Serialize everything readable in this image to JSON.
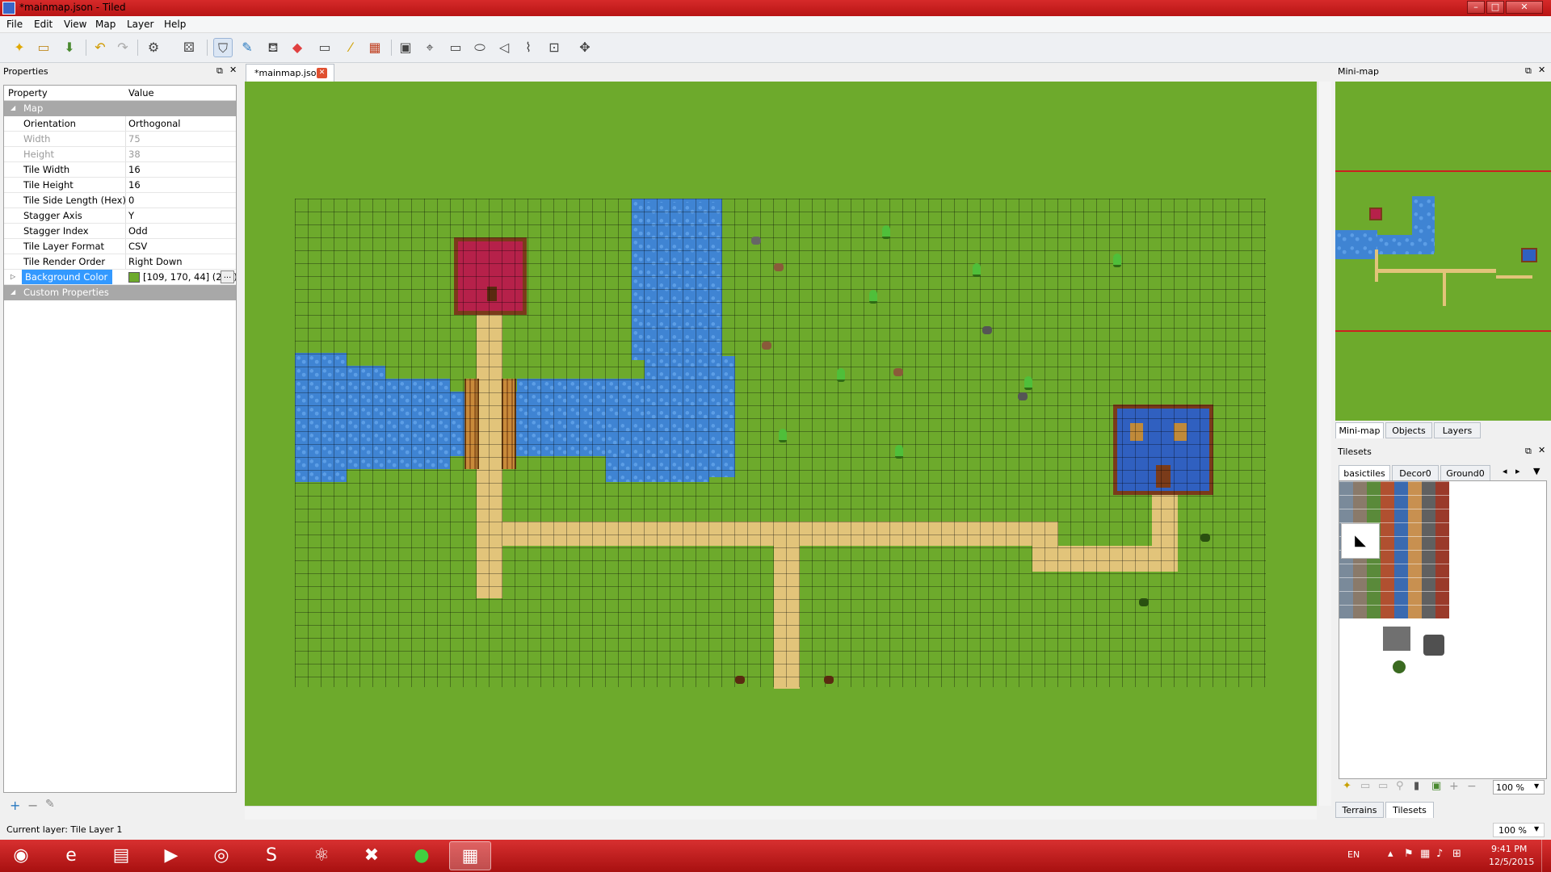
{
  "window": {
    "title": "*mainmap.json - Tiled",
    "minimize": "–",
    "maximize": "□",
    "close": "✕"
  },
  "menu": [
    "File",
    "Edit",
    "View",
    "Map",
    "Layer",
    "Help"
  ],
  "toolbar": {
    "icons": [
      "new-icon",
      "open-icon",
      "save-icon",
      "undo-icon",
      "redo-icon",
      "commands-icon",
      "random-icon",
      "stamp-brush-icon",
      "terrain-brush-icon",
      "bucket-fill-icon",
      "eraser-icon",
      "rect-select-icon",
      "magic-wand-icon",
      "select-same-tile-icon",
      "insert-image-icon",
      "edit-polygons-icon",
      "insert-rect-icon",
      "insert-ellipse-icon",
      "insert-polygon-icon",
      "insert-polyline-icon",
      "insert-tile-icon",
      "move-objects-icon"
    ]
  },
  "properties": {
    "title": "Properties",
    "col_property": "Property",
    "col_value": "Value",
    "group_map": "Map",
    "rows": [
      {
        "k": "Orientation",
        "v": "Orthogonal"
      },
      {
        "k": "Width",
        "v": "75"
      },
      {
        "k": "Height",
        "v": "38"
      },
      {
        "k": "Tile Width",
        "v": "16"
      },
      {
        "k": "Tile Height",
        "v": "16"
      },
      {
        "k": "Tile Side Length (Hex)",
        "v": "0"
      },
      {
        "k": "Stagger Axis",
        "v": "Y"
      },
      {
        "k": "Stagger Index",
        "v": "Odd"
      },
      {
        "k": "Tile Layer Format",
        "v": "CSV"
      },
      {
        "k": "Tile Render Order",
        "v": "Right Down"
      }
    ],
    "bg_color_label": "Background Color",
    "bg_color_value": "[109, 170, 44] (255)",
    "bg_color_btn": "...",
    "group_custom": "Custom Properties",
    "add": "+",
    "remove": "−",
    "rename": "✎"
  },
  "document_tab": {
    "label": "*mainmap.json"
  },
  "colors": {
    "map_background": "#6daa2c",
    "water": "#3f84d3",
    "path": "#e2c47a"
  },
  "minimap": {
    "title": "Mini-map",
    "tabs": [
      "Mini-map",
      "Objects",
      "Layers"
    ]
  },
  "tilesets": {
    "title": "Tilesets",
    "tabs": [
      "basictiles",
      "Decor0",
      "Ground0"
    ],
    "zoom": "100 %",
    "bottom_tabs": [
      "Terrains",
      "Tilesets"
    ]
  },
  "status": {
    "current_layer": "Current layer: Tile Layer 1",
    "zoom": "100 %"
  },
  "taskbar": {
    "apps": [
      "start-orb-icon",
      "internet-explorer-icon",
      "file-explorer-icon",
      "media-player-icon",
      "chrome-icon",
      "skype-icon",
      "atom-icon",
      "xampp-icon",
      "green-app-icon",
      "tiled-icon"
    ],
    "lang": "EN",
    "time": "9:41 PM",
    "date": "12/5/2015"
  }
}
